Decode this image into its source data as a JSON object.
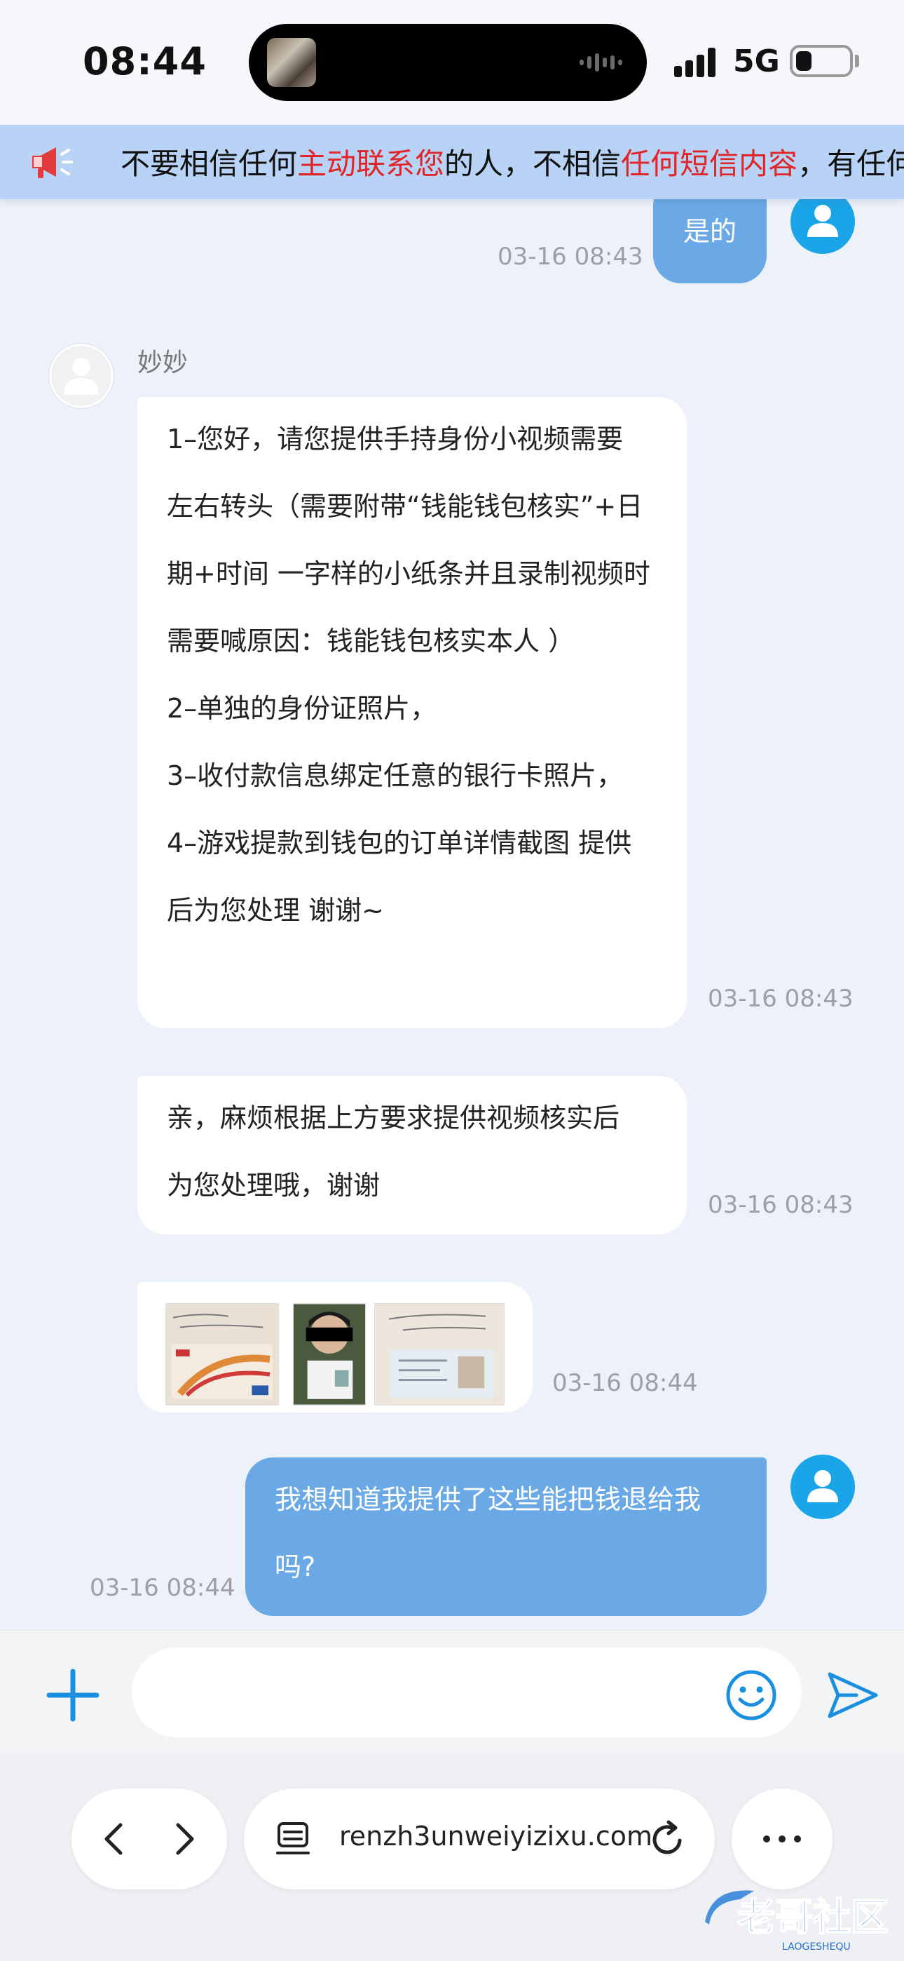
{
  "status_bar": {
    "time": "08:44",
    "network": "5G",
    "battery_level": 0.3
  },
  "notice": {
    "icon": "megaphone-icon",
    "segments": [
      {
        "text": "不要相信任何",
        "highlight": false
      },
      {
        "text": "主动联系您",
        "highlight": true
      },
      {
        "text": "的人，不相信",
        "highlight": false
      },
      {
        "text": "任何短信内容",
        "highlight": true
      },
      {
        "text": "，有任何",
        "highlight": false
      }
    ]
  },
  "messages": [
    {
      "from": "me",
      "text": "是的",
      "time": "03-16 08:43"
    },
    {
      "from": "agent",
      "sender_name": "妙妙",
      "time": "03-16 08:43",
      "lines": [
        "1–您好，请您提供手持身份小视频需要",
        "左右转头（需要附带“钱能钱包核实”+日",
        "期+时间 一字样的小纸条并且录制视频时",
        "需要喊原因：钱能钱包核实本人 ）",
        "2–单独的身份证照片，",
        "3–收付款信息绑定任意的银行卡照片，",
        "4–游戏提款到钱包的订单详情截图 提供",
        "后为您处理 谢谢~"
      ]
    },
    {
      "from": "agent",
      "time": "03-16 08:43",
      "lines": [
        "亲，麻烦根据上方要求提供视频核实后",
        "为您处理哦，谢谢"
      ]
    },
    {
      "from": "agent",
      "time": "03-16 08:44",
      "images": [
        "bank-card-photo",
        "handheld-id-photo",
        "id-card-photo"
      ]
    },
    {
      "from": "me",
      "time": "03-16 08:44",
      "lines": [
        "我想知道我提供了这些能把钱退给我",
        "吗?"
      ]
    }
  ],
  "composer": {
    "placeholder": ""
  },
  "browser": {
    "url": "renzh3unweiyizixu.com"
  },
  "watermark": {
    "text": "老哥社区",
    "subtext": "LAOGESHEQU"
  },
  "colors": {
    "accent": "#1aa5e8",
    "bubble_out": "#6aa8e6",
    "notice_bg": "#b8d3f6",
    "highlight": "#e02626"
  }
}
